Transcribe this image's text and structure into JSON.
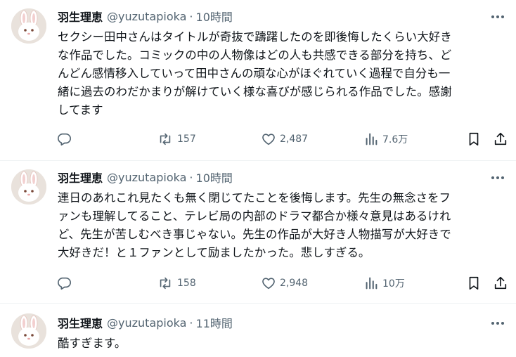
{
  "tweets": [
    {
      "author_name": "羽生理恵",
      "handle": "@yuzutapioka",
      "separator": "·",
      "time": "10時間",
      "lines": [
        "セクシー田中さんはタイトルが奇抜で躊躇したのを即後悔したくらい大好き",
        "な作品でした。コミックの中の人物像はどの人も共感できる部分を持ち、ど",
        "んどん感情移入していって田中さんの頑な心がほぐれていく過程で自分も一",
        "緒に過去のわだかまりが解けていく様な喜びが感じられる作品でした。感謝",
        "してます"
      ],
      "retweets": "157",
      "likes": "2,487",
      "views": "7.6万"
    },
    {
      "author_name": "羽生理恵",
      "handle": "@yuzutapioka",
      "separator": "·",
      "time": "10時間",
      "lines": [
        "連日のあれこれ見たくも無く閉じてたことを後悔します。先生の無念さをフ",
        "ァンも理解してること、テレビ局の内部のドラマ都合か様々意見はあるけれ",
        "ど、先生が苦しむべき事じゃない。先生の作品が大好き人物描写が大好きで",
        "大好きだ！と１ファンとして励ましたかった。悲しすぎる。"
      ],
      "retweets": "158",
      "likes": "2,948",
      "views": "10万"
    },
    {
      "author_name": "羽生理恵",
      "handle": "@yuzutapioka",
      "separator": "·",
      "time": "11時間",
      "lines": [
        "酷すぎます。"
      ]
    }
  ],
  "icons": {
    "more": "more-dots-icon",
    "reply": "reply-icon",
    "retweet": "retweet-icon",
    "like": "heart-icon",
    "views": "views-icon",
    "bookmark": "bookmark-icon",
    "share": "share-icon"
  },
  "colors": {
    "text": "#0f1419",
    "secondary": "#536471",
    "divider": "#eff3f4"
  }
}
